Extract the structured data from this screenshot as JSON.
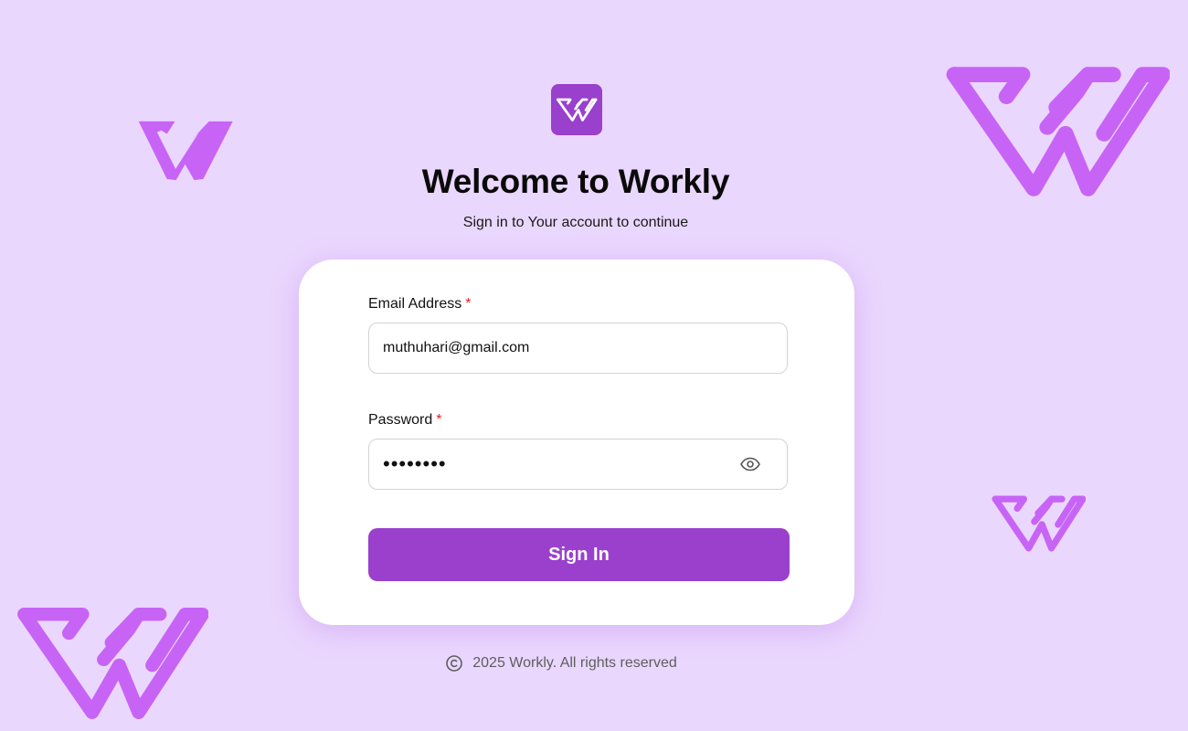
{
  "brand": {
    "name": "Workly",
    "accent_color": "#9a40cd",
    "background_color": "#ead7fd",
    "logo_icon": "workly-w-logo-icon"
  },
  "header": {
    "title": "Welcome to Workly",
    "subtitle": "Sign in to Your account to continue"
  },
  "form": {
    "email": {
      "label": "Email Address",
      "required_marker": "*",
      "value": "muthuhari@gmail.com"
    },
    "password": {
      "label": "Password",
      "required_marker": "*",
      "value_masked": "••••••••",
      "toggle_icon": "eye-icon"
    },
    "submit_label": "Sign In"
  },
  "footer": {
    "copyright_icon": "copyright-icon",
    "text": "2025 Workly. All rights reserved"
  }
}
